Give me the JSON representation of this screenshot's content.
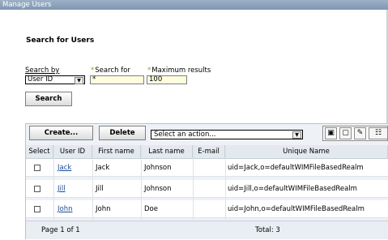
{
  "window": {
    "title": "Manage Users"
  },
  "search_section": {
    "title": "Search for Users",
    "search_by_label": "Search by",
    "search_for_label": "Search for",
    "max_results_label": "Maximum results",
    "required_marker": "*",
    "search_by_value": "User ID",
    "search_for_value": "*",
    "max_results_value": "100",
    "search_button": "Search"
  },
  "toolbar": {
    "create_button": "Create...",
    "delete_button": "Delete",
    "action_select_value": "Select an action..."
  },
  "table": {
    "columns": [
      "Select",
      "User ID",
      "First name",
      "Last name",
      "E-mail",
      "Unique Name"
    ],
    "rows": [
      {
        "user_id": "Jack",
        "first_name": "Jack",
        "last_name": "Johnson",
        "email": "",
        "unique_name": "uid=Jack,o=defaultWIMFileBasedRealm"
      },
      {
        "user_id": "Jill",
        "first_name": "Jill",
        "last_name": "Johnson",
        "email": "",
        "unique_name": "uid=Jill,o=defaultWIMFileBasedRealm"
      },
      {
        "user_id": "John",
        "first_name": "John",
        "last_name": "Doe",
        "email": "",
        "unique_name": "uid=John,o=defaultWIMFileBasedRealm"
      }
    ],
    "footer": {
      "page": "Page 1 of 1",
      "total": "Total: 3"
    }
  },
  "icons": [
    "select-all-icon",
    "deselect-all-icon",
    "edit-filter-icon",
    "clear-filter-icon"
  ]
}
